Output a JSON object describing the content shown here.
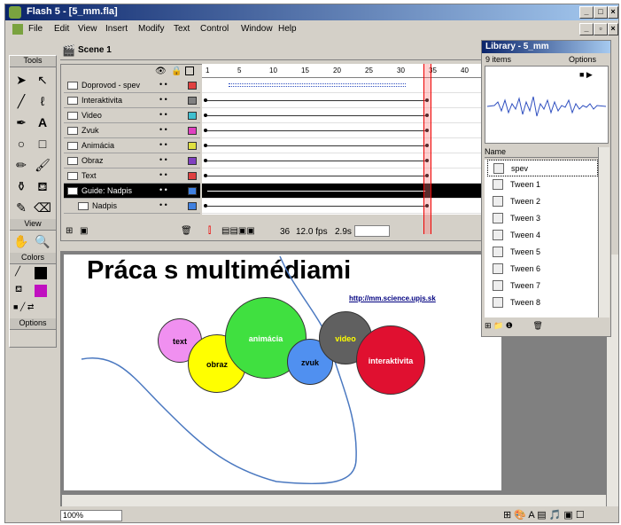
{
  "window": {
    "title": "Flash 5 - [5_mm.fla]"
  },
  "menu": [
    "File",
    "Edit",
    "View",
    "Insert",
    "Modify",
    "Text",
    "Control",
    "Window",
    "Help"
  ],
  "scene": {
    "label": "Scene 1"
  },
  "tools": {
    "header": "Tools",
    "view_header": "View",
    "colors_header": "Colors",
    "options_header": "Options"
  },
  "timeline": {
    "ruler": [
      "1",
      "5",
      "10",
      "15",
      "20",
      "25",
      "30",
      "35",
      "40"
    ],
    "layers": [
      {
        "name": "Doprovod - spev",
        "color": "#e04040"
      },
      {
        "name": "Interaktivita",
        "color": "#808080"
      },
      {
        "name": "Video",
        "color": "#40c0d0"
      },
      {
        "name": "Zvuk",
        "color": "#e040c0"
      },
      {
        "name": "Animácia",
        "color": "#e0e040"
      },
      {
        "name": "Obraz",
        "color": "#8040c0"
      },
      {
        "name": "Text",
        "color": "#e04040"
      },
      {
        "name": "Guide: Nadpis",
        "color": "#4080e0"
      },
      {
        "name": "Nadpis",
        "color": "#4080e0"
      }
    ],
    "frame_num": "36",
    "fps": "12.0 fps",
    "time": "2.9s"
  },
  "stage": {
    "title": "Práca s multimédiami",
    "url": "http://mm.science.upjs.sk",
    "circles": [
      {
        "label": "text",
        "color": "#f090f0"
      },
      {
        "label": "obraz",
        "color": "#ffff00"
      },
      {
        "label": "animácia",
        "color": "#40e040"
      },
      {
        "label": "zvuk",
        "color": "#5090f0"
      },
      {
        "label": "video",
        "color": "#606060"
      },
      {
        "label": "interaktivita",
        "color": "#e01030"
      }
    ]
  },
  "library": {
    "title": "Library - 5_mm",
    "count": "9 items",
    "options": "Options",
    "column": "Name",
    "items": [
      "spev",
      "Tween 1",
      "Tween 2",
      "Tween 3",
      "Tween 4",
      "Tween 5",
      "Tween 6",
      "Tween 7",
      "Tween 8"
    ]
  },
  "zoom": "100%"
}
